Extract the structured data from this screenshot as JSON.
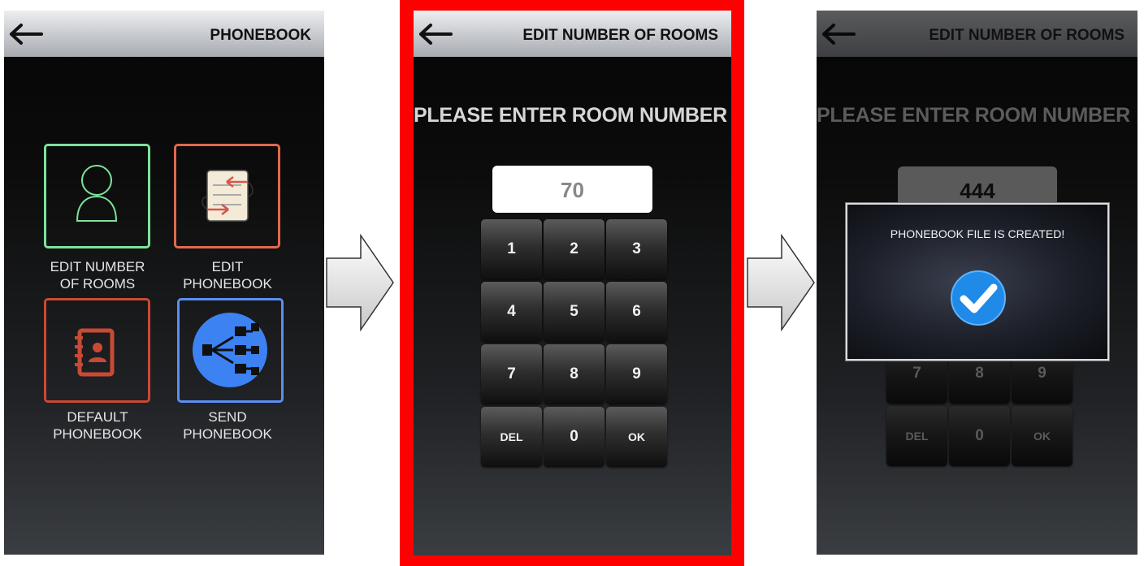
{
  "screen1": {
    "title": "PHONEBOOK",
    "menu": [
      {
        "label": "EDIT NUMBER\nOF ROOMS",
        "icon": "user-icon"
      },
      {
        "label": "EDIT\nPHONEBOOK",
        "icon": "edit-document-icon"
      },
      {
        "label": "DEFAULT\nPHONEBOOK",
        "icon": "contact-book-icon"
      },
      {
        "label": "SEND\nPHONEBOOK",
        "icon": "share-send-icon"
      }
    ]
  },
  "screen2": {
    "title": "EDIT NUMBER OF ROOMS",
    "prompt": "PLEASE ENTER ROOM NUMBER !",
    "value": "70",
    "keys": [
      "1",
      "2",
      "3",
      "4",
      "5",
      "6",
      "7",
      "8",
      "9",
      "DEL",
      "0",
      "OK"
    ]
  },
  "screen3": {
    "title": "EDIT NUMBER OF ROOMS",
    "prompt": "PLEASE ENTER ROOM NUMBER !",
    "value": "444",
    "keys": [
      "7",
      "8",
      "9",
      "DEL",
      "0",
      "OK"
    ],
    "dialog": {
      "message": "PHONEBOOK FILE IS CREATED!",
      "icon": "check-circle-icon"
    }
  },
  "colors": {
    "tile_edit_rooms": "#7de39a",
    "tile_edit_phonebook": "#e0694f",
    "tile_default_phonebook": "#c94a34",
    "tile_send_phonebook": "#5b8ff0",
    "highlight_frame": "#ff0000",
    "send_circle": "#3c82f2"
  }
}
